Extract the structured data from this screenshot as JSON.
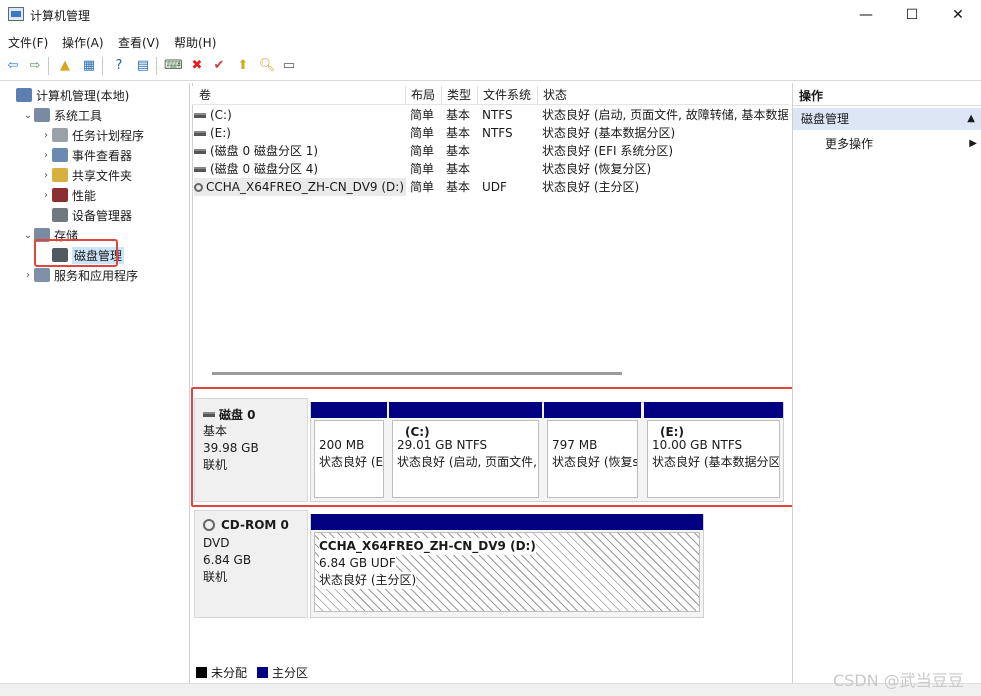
{
  "window": {
    "title": "计算机管理",
    "minimize_glyph": "—",
    "maximize_glyph": "☐",
    "close_glyph": "✕"
  },
  "menu": [
    "文件(F)",
    "操作(A)",
    "查看(V)",
    "帮助(H)"
  ],
  "toolbar": [
    {
      "name": "back-icon",
      "glyph": "⇦",
      "color": "#2a7fd4"
    },
    {
      "name": "forward-icon",
      "glyph": "⇨",
      "color": "#6a8a6a"
    },
    {
      "name": "up-folder-icon",
      "glyph": "▲",
      "color": "#d8a520"
    },
    {
      "name": "show-hide-tree-icon",
      "glyph": "▦",
      "color": "#2a6fb0"
    },
    {
      "name": "help-icon",
      "glyph": "?",
      "color": "#2a5ea8"
    },
    {
      "name": "properties-icon",
      "glyph": "▤",
      "color": "#2a6fb0"
    },
    {
      "name": "connect-icon",
      "glyph": "⌨",
      "color": "#4a6a4a"
    },
    {
      "name": "delete-icon",
      "glyph": "✖",
      "color": "#e02020"
    },
    {
      "name": "check-icon",
      "glyph": "✔",
      "color": "#d04040"
    },
    {
      "name": "import-icon",
      "glyph": "⬆",
      "color": "#d8a520"
    },
    {
      "name": "search-icon",
      "glyph": "🔍︎",
      "color": "#c8a020"
    },
    {
      "name": "list-view-icon",
      "glyph": "▭",
      "color": "#555555"
    }
  ],
  "tree": [
    {
      "label": "计算机管理(本地)",
      "indent": 0,
      "chev": "",
      "icon_color": "#5a7fb0",
      "name": "tree-computer-management"
    },
    {
      "label": "系统工具",
      "indent": 1,
      "chev": "⌄",
      "icon_color": "#7a8aa0",
      "name": "tree-system-tools"
    },
    {
      "label": "任务计划程序",
      "indent": 2,
      "chev": "›",
      "icon_color": "#9aa0a8",
      "name": "tree-task-scheduler"
    },
    {
      "label": "事件查看器",
      "indent": 2,
      "chev": "›",
      "icon_color": "#6a8ab0",
      "name": "tree-event-viewer"
    },
    {
      "label": "共享文件夹",
      "indent": 2,
      "chev": "›",
      "icon_color": "#d8b040",
      "name": "tree-shared-folders"
    },
    {
      "label": "性能",
      "indent": 2,
      "chev": "›",
      "icon_color": "#8a3030",
      "name": "tree-performance"
    },
    {
      "label": "设备管理器",
      "indent": 2,
      "chev": "",
      "icon_color": "#707880",
      "name": "tree-device-manager"
    },
    {
      "label": "存储",
      "indent": 1,
      "chev": "⌄",
      "icon_color": "#7a8aa0",
      "name": "tree-storage"
    },
    {
      "label": "磁盘管理",
      "indent": 2,
      "chev": "",
      "icon_color": "#505860",
      "name": "tree-disk-management",
      "selected": true
    },
    {
      "label": "服务和应用程序",
      "indent": 1,
      "chev": "›",
      "icon_color": "#8090a8",
      "name": "tree-services-apps"
    }
  ],
  "volume_table": {
    "headers": [
      "卷",
      "布局",
      "类型",
      "文件系统",
      "状态"
    ],
    "rows": [
      {
        "vol": "(C:)",
        "layout": "简单",
        "type": "基本",
        "fs": "NTFS",
        "status": "状态良好 (启动, 页面文件, 故障转储, 基本数据分区)",
        "icon": "disk"
      },
      {
        "vol": "(E:)",
        "layout": "简单",
        "type": "基本",
        "fs": "NTFS",
        "status": "状态良好 (基本数据分区)",
        "icon": "disk"
      },
      {
        "vol": "(磁盘 0 磁盘分区 1)",
        "layout": "简单",
        "type": "基本",
        "fs": "",
        "status": "状态良好 (EFI 系统分区)",
        "icon": "disk"
      },
      {
        "vol": "(磁盘 0 磁盘分区 4)",
        "layout": "简单",
        "type": "基本",
        "fs": "",
        "status": "状态良好 (恢复分区)",
        "icon": "disk"
      },
      {
        "vol": "CCHA_X64FREO_ZH-CN_DV9 (D:)",
        "layout": "简单",
        "type": "基本",
        "fs": "UDF",
        "status": "状态良好 (主分区)",
        "icon": "cd"
      }
    ]
  },
  "disks": [
    {
      "name": "磁盘 0",
      "kind": "基本",
      "size": "39.98 GB",
      "state": "联机",
      "partitions": [
        {
          "title": "",
          "size": "200 MB",
          "status": "状态良好 (E"
        },
        {
          "title": "(C:)",
          "size": "29.01 GB NTFS",
          "status": "状态良好 (启动, 页面文件,"
        },
        {
          "title": "",
          "size": "797 MB",
          "status": "状态良好 (恢复s"
        },
        {
          "title": "(E:)",
          "size": "10.00 GB NTFS",
          "status": "状态良好 (基本数据分区"
        }
      ]
    },
    {
      "name": "CD-ROM 0",
      "kind": "DVD",
      "size": "6.84 GB",
      "state": "联机",
      "partitions": [
        {
          "title": "CCHA_X64FREO_ZH-CN_DV9  (D:)",
          "size": "6.84 GB UDF",
          "status": "状态良好 (主分区)"
        }
      ]
    }
  ],
  "legend": [
    {
      "label": "未分配",
      "color": "#000000"
    },
    {
      "label": "主分区",
      "color": "#000080"
    }
  ],
  "actions": {
    "header": "操作",
    "section": "磁盘管理",
    "more": "更多操作"
  },
  "watermark": "CSDN @武当豆豆"
}
